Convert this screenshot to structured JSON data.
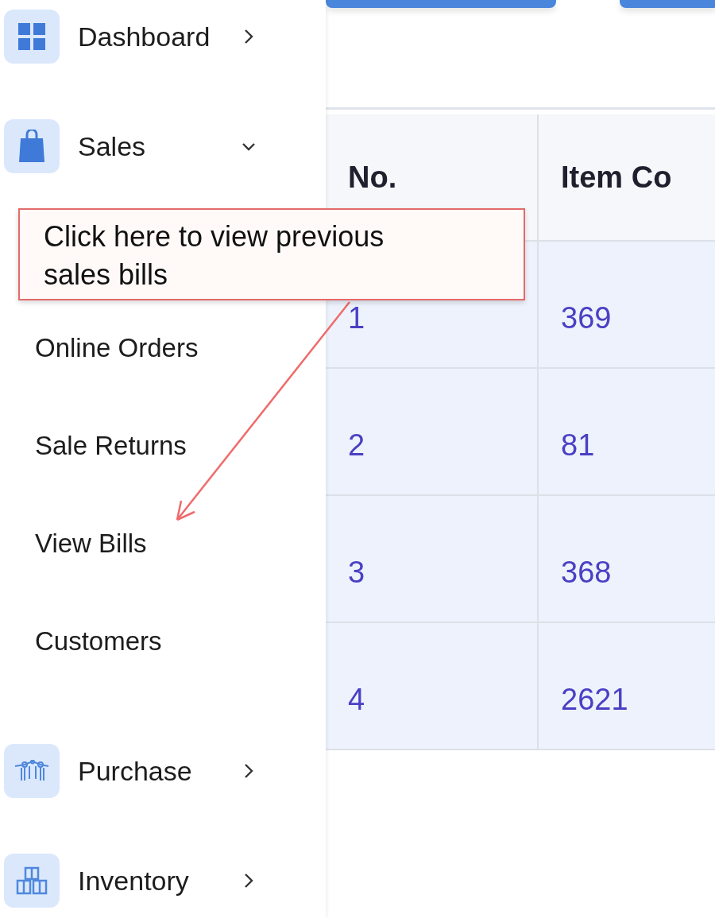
{
  "sidebar": {
    "items": [
      {
        "label": "Dashboard",
        "expanded": false
      },
      {
        "label": "Sales",
        "expanded": true,
        "children": [
          {
            "label": "Online Orders"
          },
          {
            "label": "Sale Returns"
          },
          {
            "label": "View Bills"
          },
          {
            "label": "Customers"
          }
        ]
      },
      {
        "label": "Purchase",
        "expanded": false
      },
      {
        "label": "Inventory",
        "expanded": false
      }
    ]
  },
  "table": {
    "columns": [
      "No.",
      "Item Co"
    ],
    "rows": [
      [
        "1",
        "369"
      ],
      [
        "2",
        "81"
      ],
      [
        "3",
        "368"
      ],
      [
        "4",
        "2621"
      ]
    ]
  },
  "callout": {
    "text": "Click here to view previous sales bills"
  }
}
